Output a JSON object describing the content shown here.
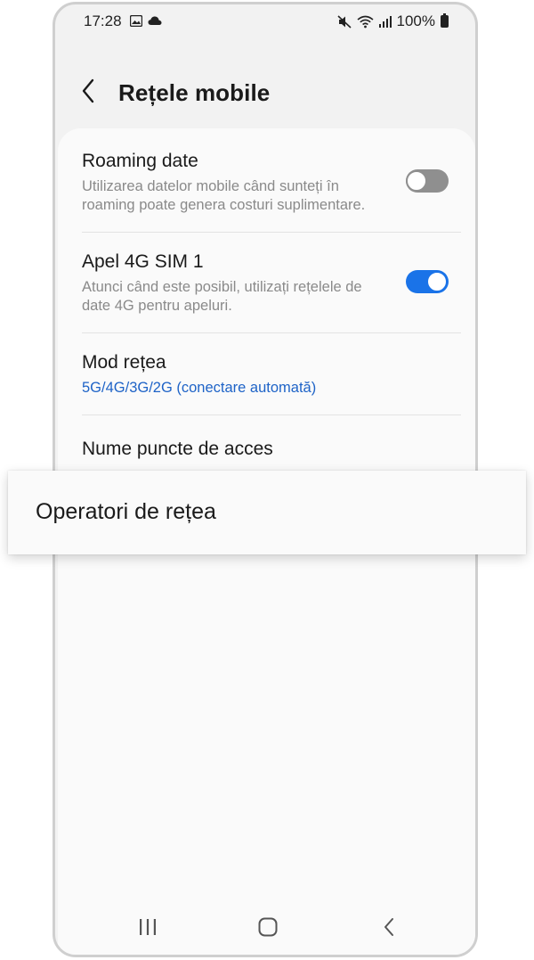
{
  "status_bar": {
    "time": "17:28",
    "battery_text": "100%"
  },
  "header": {
    "title": "Rețele mobile"
  },
  "settings": [
    {
      "title": "Roaming date",
      "subtitle": "Utilizarea datelor mobile când sunteți în roaming poate genera costuri suplimentare.",
      "toggle": "off"
    },
    {
      "title": "Apel 4G SIM 1",
      "subtitle": "Atunci când este posibil, utilizați rețelele de date 4G pentru apeluri.",
      "toggle": "on"
    },
    {
      "title": "Mod rețea",
      "subtitle": "5G/4G/3G/2G (conectare automată)"
    },
    {
      "title": "Nume puncte de acces"
    }
  ],
  "popup": {
    "label": "Operatori de rețea"
  },
  "nav": {
    "recents_icon": "recents-icon",
    "home_icon": "home-icon",
    "back_icon": "back-icon"
  },
  "colors": {
    "accent": "#1a73e8",
    "link": "#1e63c7",
    "toggle_off": "#8f8f8f"
  }
}
